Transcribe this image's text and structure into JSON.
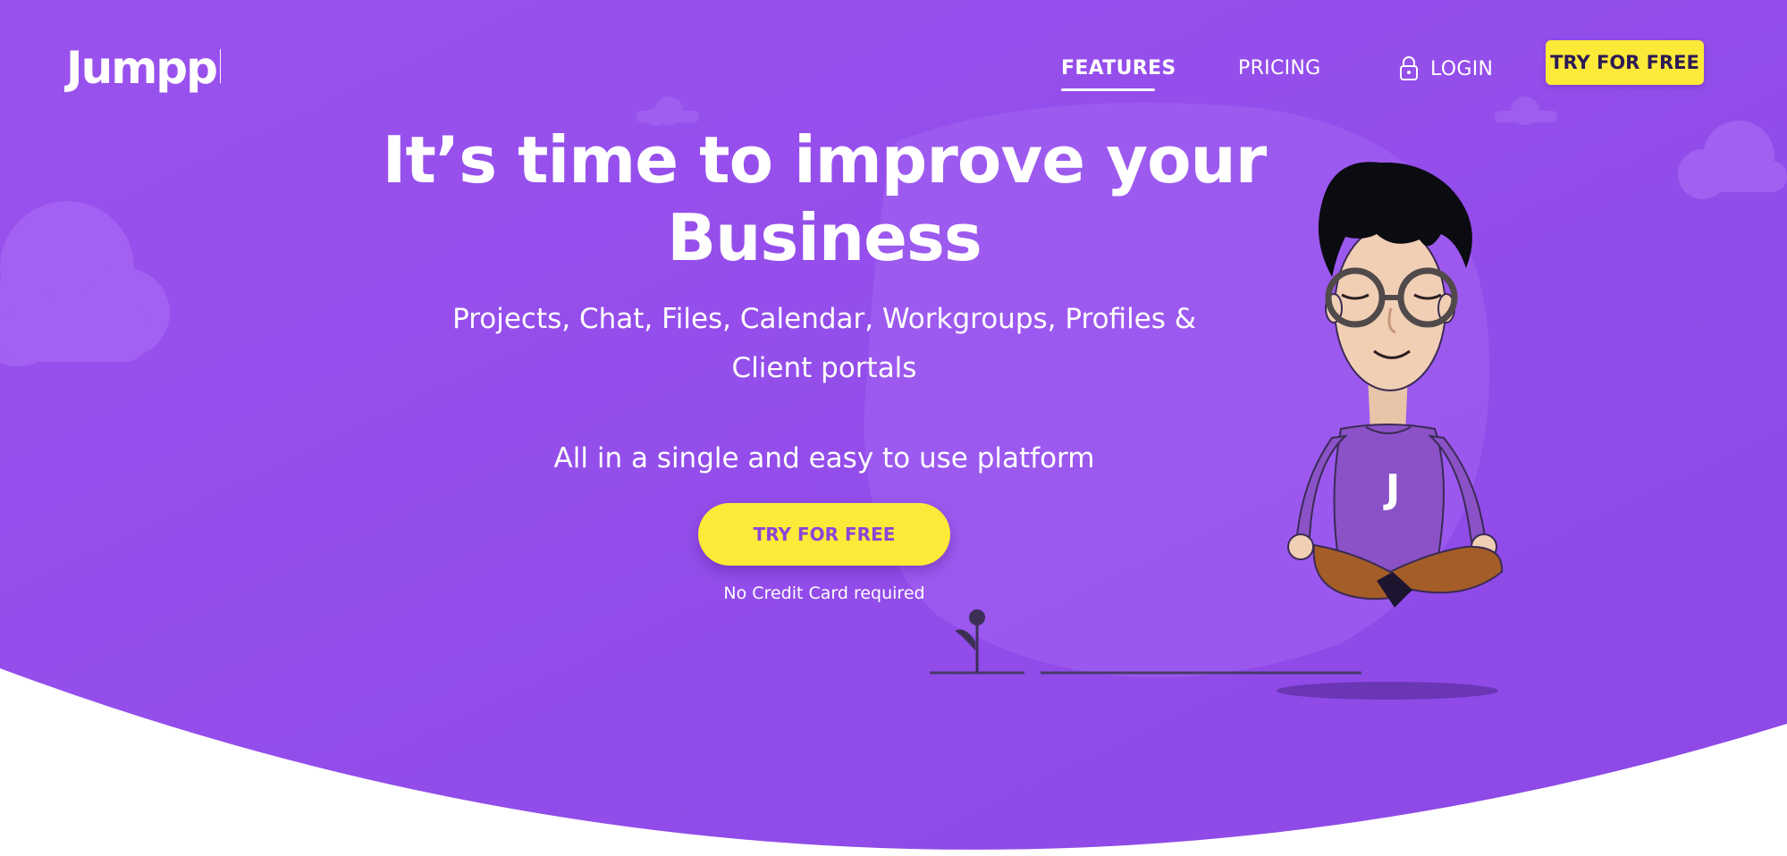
{
  "brand": {
    "logo_text": "Jumppl",
    "primary_color": "#9650ea",
    "accent_color": "#fde937"
  },
  "nav": {
    "features_label": "FEATURES",
    "pricing_label": "PRICING",
    "login_label": "LOGIN",
    "login_icon": "lock-icon",
    "cta_label": "TRY FOR FREE"
  },
  "hero": {
    "headline_line1": "It’s time to improve your",
    "headline_line2": "Business",
    "subhead_line1": "Projects, Chat, Files, Calendar, Workgroups, Profiles &",
    "subhead_line2": "Client portals",
    "tagline": "All in a single and easy to use platform",
    "cta_label": "TRY FOR FREE",
    "cta_note": "No Credit Card required"
  },
  "illustration": {
    "description_icon": "meditating-man-illustration",
    "shirt_letter": "J"
  }
}
